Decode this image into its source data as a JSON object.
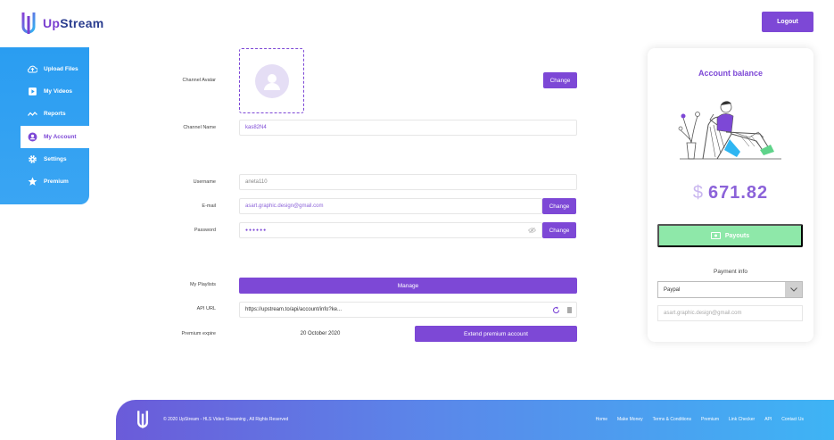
{
  "brand": {
    "name_part1": "Up",
    "name_part2": "Stream"
  },
  "header": {
    "logout_label": "Logout"
  },
  "sidebar": {
    "items": [
      {
        "label": "Upload Files",
        "icon": "cloud-upload-icon"
      },
      {
        "label": "My Videos",
        "icon": "video-icon"
      },
      {
        "label": "Reports",
        "icon": "chart-icon"
      },
      {
        "label": "My Account",
        "icon": "user-icon",
        "active": true
      },
      {
        "label": "Settings",
        "icon": "gear-icon"
      },
      {
        "label": "Premium",
        "icon": "star-icon"
      }
    ]
  },
  "form": {
    "avatar_label": "Channel Avatar",
    "avatar_change": "Change",
    "channel_name_label": "Channel Name",
    "channel_name_value": "kas82N4",
    "username_label": "Username",
    "username_value": "aneta110",
    "email_label": "E-mail",
    "email_value": "asart.graphic.design@gmail.com",
    "email_change": "Change",
    "password_label": "Password",
    "password_value": "●●●●●●",
    "password_change": "Change",
    "playlists_label": "My Playlists",
    "playlists_button": "Manage",
    "api_label": "API URL",
    "api_value": "https://upstream.to/api/account/info?ke...",
    "premium_label": "Premium expire",
    "premium_value": "20 October 2020",
    "premium_button": "Extend premium account"
  },
  "account": {
    "title": "Account balance",
    "currency": "$",
    "balance": "671.82",
    "payouts_label": "Payouts",
    "payment_info_label": "Payment info",
    "payment_method": "Paypal",
    "payment_email": "asart.graphic.design@gmail.com"
  },
  "footer": {
    "copyright": "© 2020 UpStream - HLS Video Streaming , All Rights Reserved",
    "links": [
      "Home",
      "Make Money",
      "Terms & Conditions",
      "Premium",
      "Link Checker",
      "API",
      "Contact Us"
    ]
  },
  "colors": {
    "accent": "#7d48d6",
    "sidebar": "#2a9df1",
    "payouts": "#8ee8a9"
  }
}
